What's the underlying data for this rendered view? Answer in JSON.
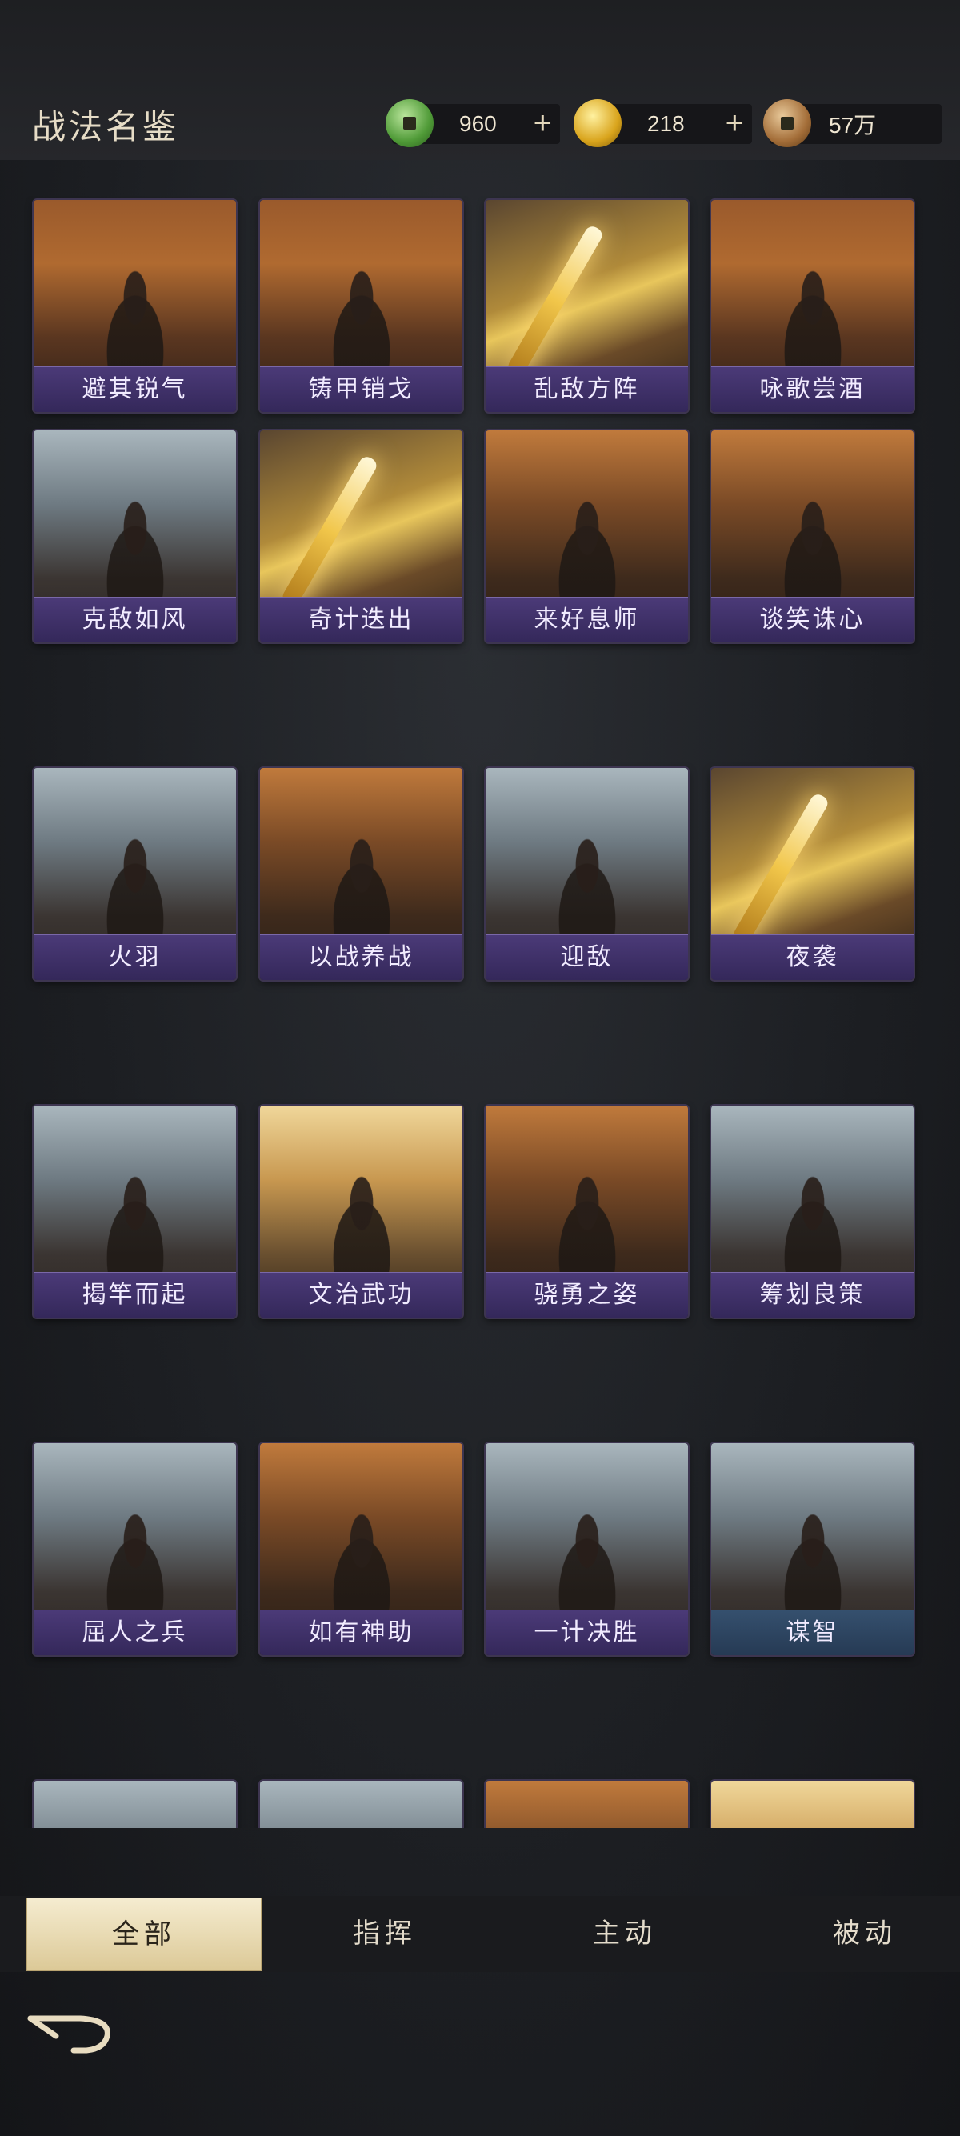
{
  "header": {
    "title": "战法名鉴"
  },
  "resources": [
    {
      "name": "jade-coin",
      "value": "960",
      "has_plus": true
    },
    {
      "name": "gold-ingot",
      "value": "218",
      "has_plus": true
    },
    {
      "name": "copper-coin",
      "value": "57万",
      "has_plus": false
    }
  ],
  "plus_label": "+",
  "cards": [
    {
      "label": "避其锐气",
      "art": "general"
    },
    {
      "label": "铸甲销戈",
      "art": "general"
    },
    {
      "label": "乱敌方阵",
      "art": "sword"
    },
    {
      "label": "咏歌尝酒",
      "art": "general"
    },
    {
      "label": "克敌如风",
      "art": "knight"
    },
    {
      "label": "奇计迭出",
      "art": "sword"
    },
    {
      "label": "来好息师",
      "art": "warrior"
    },
    {
      "label": "谈笑诛心",
      "art": "warrior"
    },
    {
      "label": "火羽",
      "art": "knight"
    },
    {
      "label": "以战养战",
      "art": "warrior"
    },
    {
      "label": "迎敌",
      "art": "knight"
    },
    {
      "label": "夜袭",
      "art": "sword"
    },
    {
      "label": "揭竿而起",
      "art": "knight"
    },
    {
      "label": "文治武功",
      "art": "golden"
    },
    {
      "label": "骁勇之姿",
      "art": "warrior"
    },
    {
      "label": "筹划良策",
      "art": "knight"
    },
    {
      "label": "屈人之兵",
      "art": "knight"
    },
    {
      "label": "如有神助",
      "art": "warrior"
    },
    {
      "label": "一计决胜",
      "art": "knight"
    },
    {
      "label": "谋智",
      "art": "knight",
      "blue": true
    },
    {
      "label": "",
      "art": "knight"
    },
    {
      "label": "",
      "art": "knight"
    },
    {
      "label": "",
      "art": "warrior"
    },
    {
      "label": "",
      "art": "golden"
    }
  ],
  "tabs": [
    {
      "label": "全部",
      "active": true
    },
    {
      "label": "指挥",
      "active": false
    },
    {
      "label": "主动",
      "active": false
    },
    {
      "label": "被动",
      "active": false
    }
  ],
  "icons": {
    "back": "back-arrow-icon"
  }
}
